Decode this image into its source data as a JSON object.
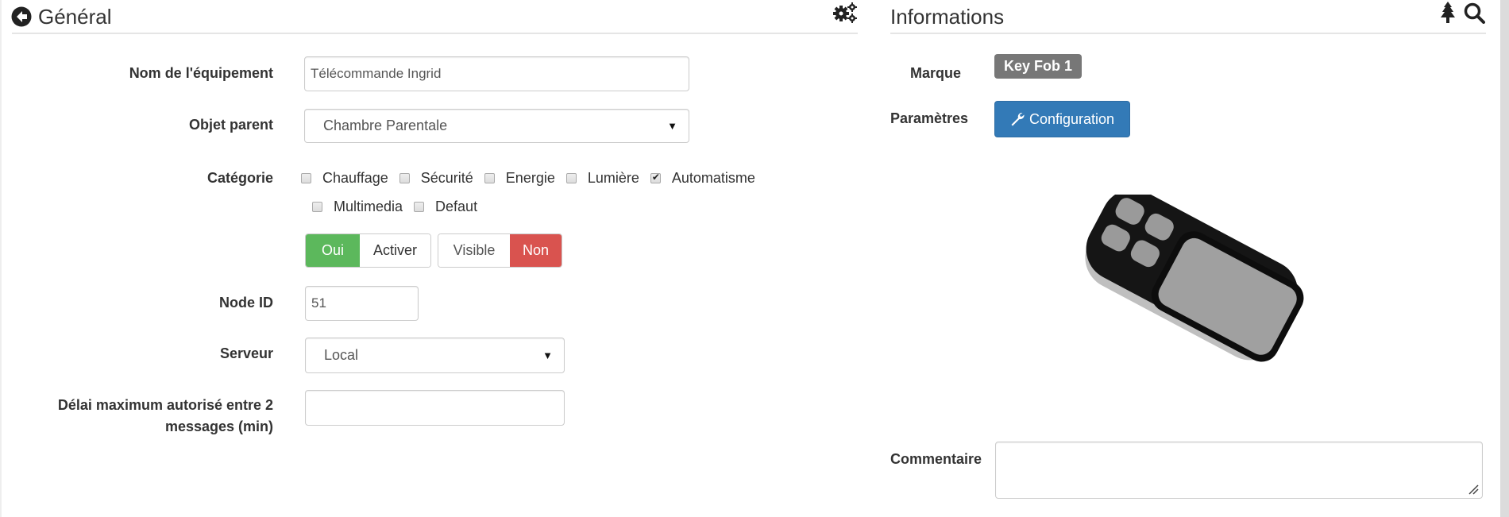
{
  "general": {
    "title": "Général",
    "back_icon": "arrow-circle-left-icon",
    "settings_icon": "cogs-icon",
    "fields": {
      "name_label": "Nom de l'équipement",
      "name_value": "Télécommande Ingrid",
      "parent_label": "Objet parent",
      "parent_value": "Chambre Parentale",
      "category_label": "Catégorie",
      "categories": [
        {
          "label": "Chauffage",
          "checked": false
        },
        {
          "label": "Sécurité",
          "checked": false
        },
        {
          "label": "Energie",
          "checked": false
        },
        {
          "label": "Lumière",
          "checked": false
        },
        {
          "label": "Automatisme",
          "checked": true
        },
        {
          "label": "Multimedia",
          "checked": false
        },
        {
          "label": "Defaut",
          "checked": false
        }
      ],
      "enable_toggle": {
        "on_label": "Oui",
        "label": "Activer",
        "state": "Oui"
      },
      "visible_toggle": {
        "label": "Visible",
        "off_label": "Non",
        "state": "Non"
      },
      "node_id_label": "Node ID",
      "node_id_value": "51",
      "server_label": "Serveur",
      "server_value": "Local",
      "delay_label_line1": "Délai maximum autorisé entre 2",
      "delay_label_line2": "messages (min)",
      "delay_value": ""
    }
  },
  "informations": {
    "title": "Informations",
    "tree_icon": "tree-icon",
    "search_icon": "search-icon",
    "brand_label": "Marque",
    "brand_value": "Key Fob 1",
    "params_label": "Paramètres",
    "config_button": "Configuration",
    "config_icon": "wrench-icon",
    "device_image": "key-fob-remote",
    "comment_label": "Commentaire",
    "comment_value": ""
  },
  "colors": {
    "success": "#5cb85c",
    "danger": "#d9534f",
    "primary": "#337ab7",
    "badge": "#777777"
  }
}
